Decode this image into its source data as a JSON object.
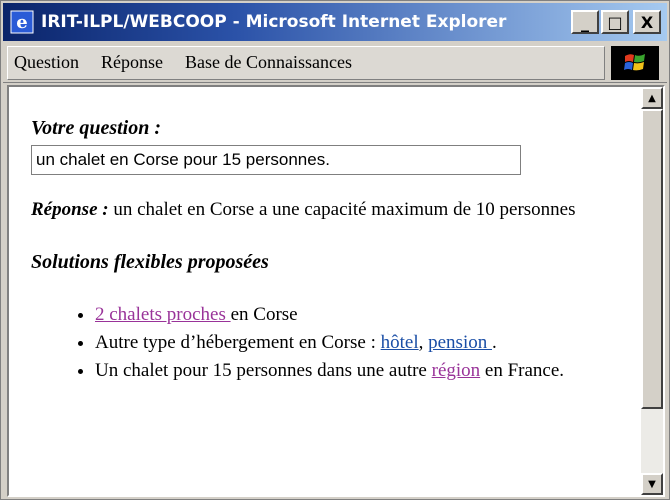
{
  "window": {
    "title": "IRIT-ILPL/WEBCOOP - Microsoft Internet Explorer",
    "minimize": "_",
    "maximize": "□",
    "close": "X"
  },
  "menu": {
    "items": [
      "Question",
      "Réponse",
      "Base de Connaissances"
    ]
  },
  "content": {
    "question_label": "Votre question :",
    "question_value": "un chalet en Corse pour 15 personnes.",
    "answer_label": "Réponse :",
    "answer_text": " un chalet en Corse a une capacité maximum de 10 personnes",
    "solutions_title": "Solutions flexibles proposées",
    "solutions": {
      "item1_link": "2 chalets proches ",
      "item1_text": "en Corse",
      "item2_text": "Autre type d’hébergement en Corse : ",
      "item2_link1": "hôtel",
      "item2_sep": ", ",
      "item2_link2": "pension ",
      "item2_end": ".",
      "item3_text": "Un chalet pour 15 personnes dans une autre ",
      "item3_link": "région",
      "item3_end": " en France."
    }
  },
  "colors": {
    "visited_link": "#993399",
    "link": "#1a4ea6",
    "titlebar": "#0a246a"
  },
  "icons": [
    "ie-icon",
    "windows-logo-icon",
    "scroll-up-icon",
    "scroll-down-icon"
  ]
}
